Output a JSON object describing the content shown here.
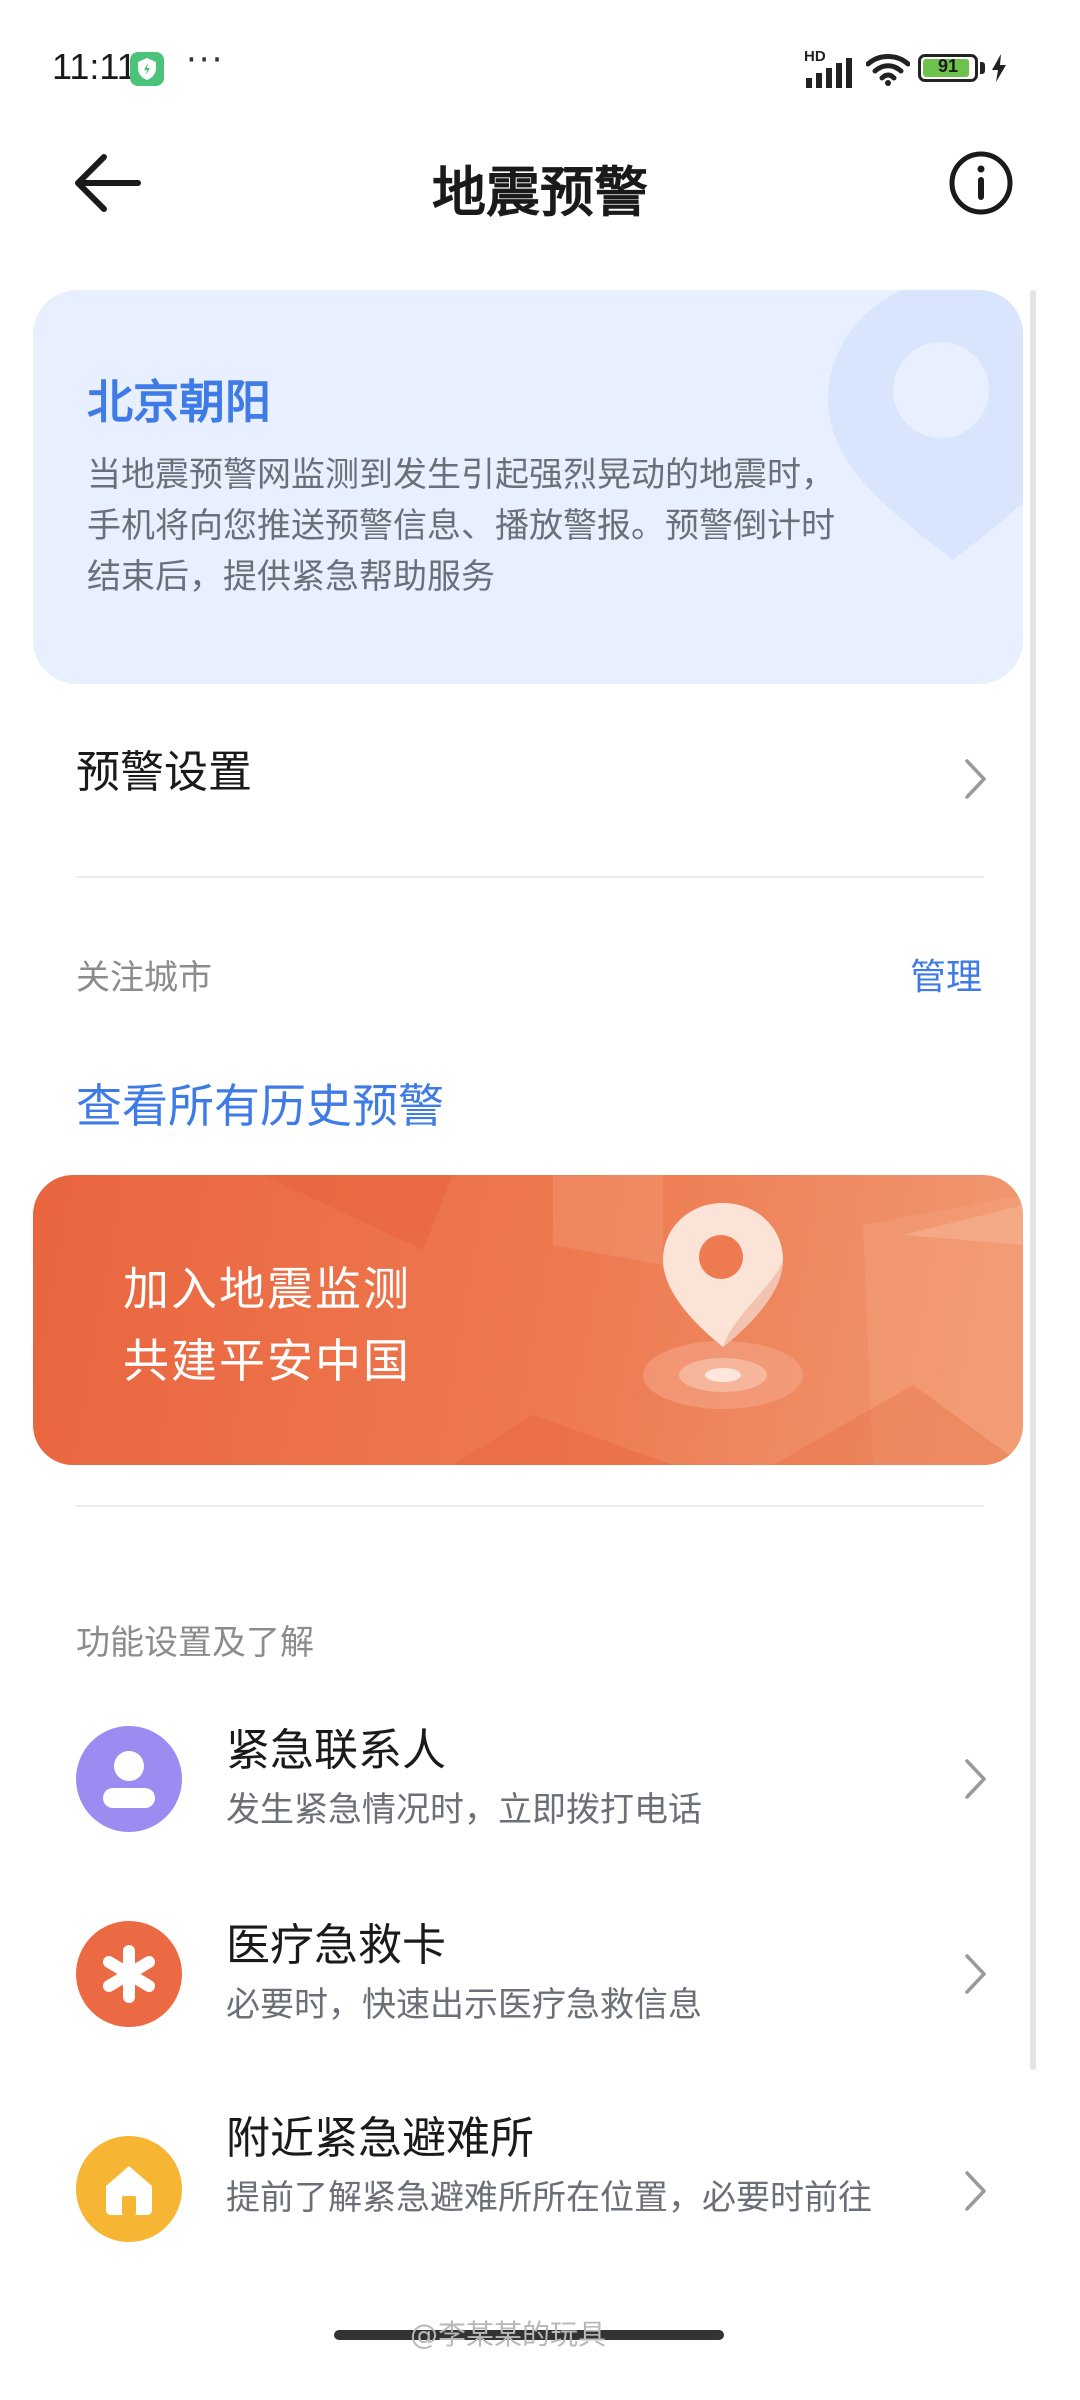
{
  "status_bar": {
    "time": "11:11",
    "more": "···",
    "network": "HD",
    "battery": "91",
    "battery_level": 0.91
  },
  "header": {
    "title": "地震预警",
    "back_icon": "arrow-left-icon",
    "info_icon": "info-circle-icon"
  },
  "location_card": {
    "name": "北京朝阳",
    "description": "当地震预警网监测到发生引起强烈晃动的地震时，手机将向您推送预警信息、播放警报。预警倒计时结束后，提供紧急帮助服务"
  },
  "warning_settings": {
    "label": "预警设置"
  },
  "followed_cities": {
    "label": "关注城市",
    "manage": "管理"
  },
  "history_link": "查看所有历史预警",
  "banner": {
    "line1": "加入地震监测",
    "line2": "共建平安中国"
  },
  "functions": {
    "section_label": "功能设置及了解",
    "items": [
      {
        "title": "紧急联系人",
        "subtitle": "发生紧急情况时，立即拨打电话",
        "icon": "person-icon",
        "color": "#9b8cf2"
      },
      {
        "title": "医疗急救卡",
        "subtitle": "必要时，快速出示医疗急救信息",
        "icon": "asterisk-icon",
        "color": "#ec6a43"
      },
      {
        "title": "附近紧急避难所",
        "subtitle": "提前了解紧急避难所所在位置，必要时前往",
        "icon": "home-icon",
        "color": "#f6b533"
      }
    ]
  },
  "watermark": "@李某某的玩具",
  "colors": {
    "accent": "#3f7be6",
    "card_bg": "#e8efff",
    "banner": "#e9643f"
  }
}
